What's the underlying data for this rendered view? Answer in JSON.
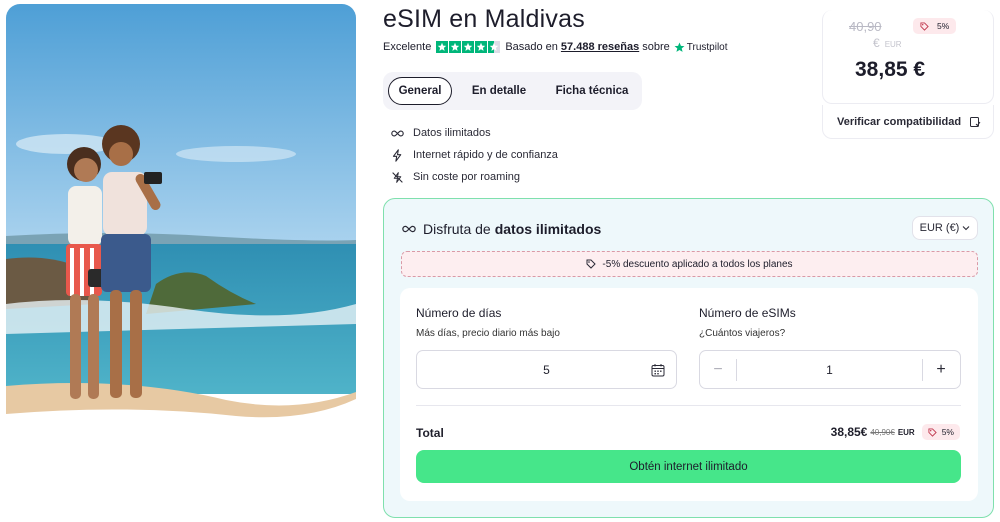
{
  "product": {
    "title": "eSIM en Maldivas",
    "rating": {
      "label": "Excelente",
      "stars": 4.5,
      "based_on": "Basado en",
      "review_count": "57.488 reseñas",
      "source_prefix": "sobre",
      "source": "Trustpilot"
    }
  },
  "tabs": [
    {
      "label": "General",
      "active": true
    },
    {
      "label": "En detalle",
      "active": false
    },
    {
      "label": "Ficha técnica",
      "active": false
    }
  ],
  "features": [
    {
      "icon": "infinity-icon",
      "label": "Datos ilimitados"
    },
    {
      "icon": "lightning-icon",
      "label": "Internet rápido y de confianza"
    },
    {
      "icon": "no-roaming-icon",
      "label": "Sin coste por roaming"
    }
  ],
  "price_card": {
    "old_price": "40,90",
    "old_currency_symbol": "€",
    "old_currency_code": "EUR",
    "discount": "5%",
    "price": "38,85 €",
    "compat_label": "Verificar compatibilidad"
  },
  "panel": {
    "heading_prefix": "Disfruta de",
    "heading_bold": "datos ilimitados",
    "currency": "EUR (€)",
    "discount_notice": "-5% descuento aplicado a todos los planes",
    "days": {
      "label": "Número de días",
      "sub": "Más días, precio diario más bajo",
      "value": "5"
    },
    "esims": {
      "label": "Número de eSIMs",
      "sub": "¿Cuántos viajeros?",
      "minus": "−",
      "plus": "+",
      "value": "1"
    },
    "total": {
      "label": "Total",
      "amount": "38,85€",
      "old": "40,90€",
      "currency": "EUR",
      "discount": "5%"
    },
    "cta": "Obtén internet ilimitado"
  },
  "colors": {
    "accent_green": "#46e68a",
    "trustpilot_green": "#00b67a",
    "panel_border": "#7fe0ad",
    "discount_bg": "#fde9ec"
  }
}
